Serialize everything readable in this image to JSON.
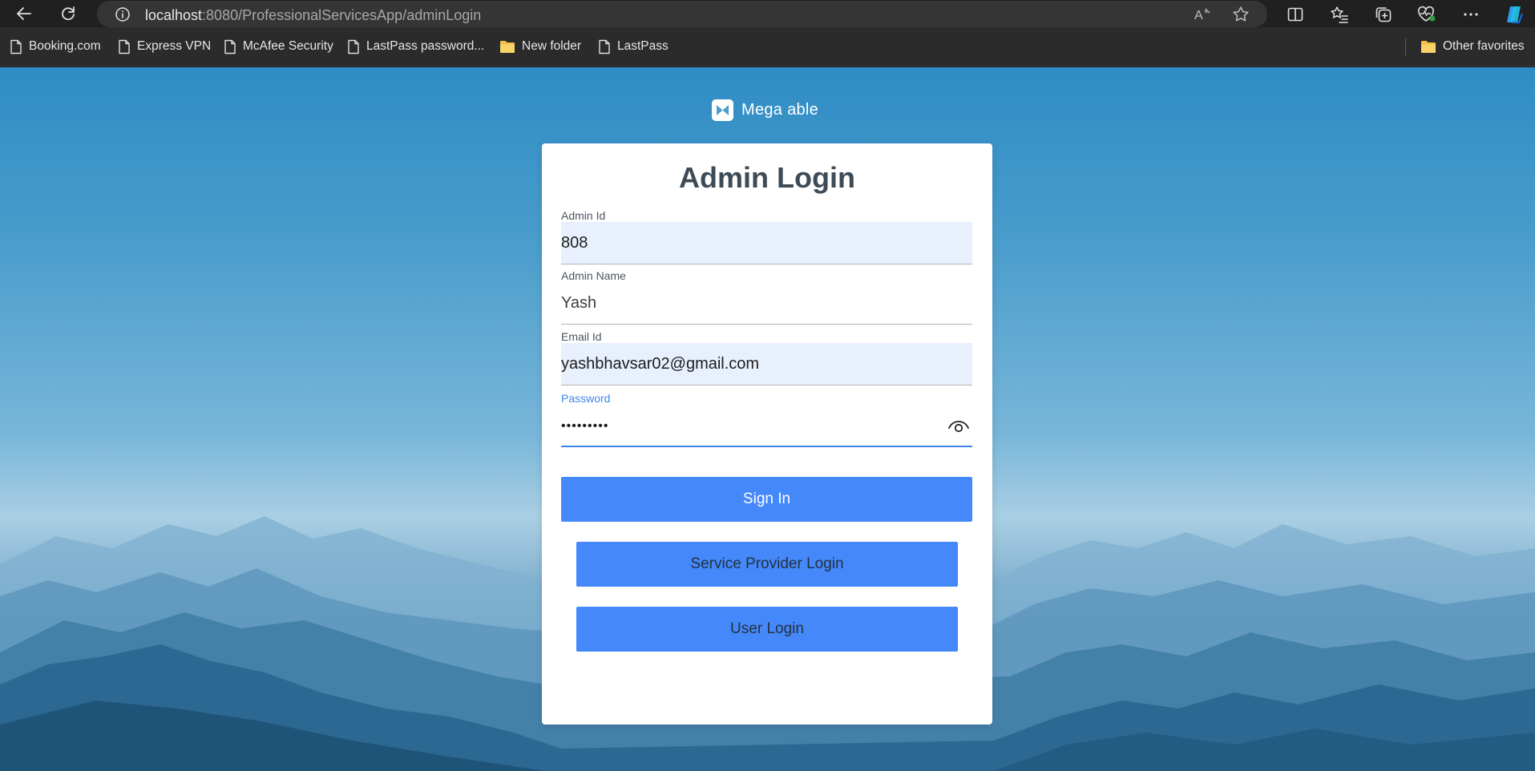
{
  "browser": {
    "url_host": "localhost",
    "url_path": ":8080/ProfessionalServicesApp/adminLogin",
    "read_aloud_label": "A",
    "bookmarks": [
      {
        "label": "Booking.com",
        "icon": "page-icon"
      },
      {
        "label": "Express VPN",
        "icon": "page-icon"
      },
      {
        "label": "McAfee Security",
        "icon": "page-icon"
      },
      {
        "label": "LastPass password...",
        "icon": "page-icon"
      },
      {
        "label": "New folder",
        "icon": "folder-icon"
      },
      {
        "label": "LastPass",
        "icon": "page-icon"
      }
    ],
    "other_favorites": "Other favorites"
  },
  "brand": {
    "name": "Mega able"
  },
  "login": {
    "title": "Admin Login",
    "admin_id": {
      "label": "Admin Id",
      "value": "808"
    },
    "admin_name": {
      "label": "Admin Name",
      "value": "Yash"
    },
    "email": {
      "label": "Email Id",
      "value": "yashbhavsar02@gmail.com"
    },
    "password": {
      "label": "Password",
      "value": "•••••••••"
    },
    "sign_in": "Sign In",
    "service_provider_login": "Service Provider Login",
    "user_login": "User Login"
  },
  "colors": {
    "primary_button": "#4488fa",
    "focus_accent": "#3f86ee",
    "autofill_background": "#e8f0fe",
    "title_text": "#3d4b57"
  }
}
